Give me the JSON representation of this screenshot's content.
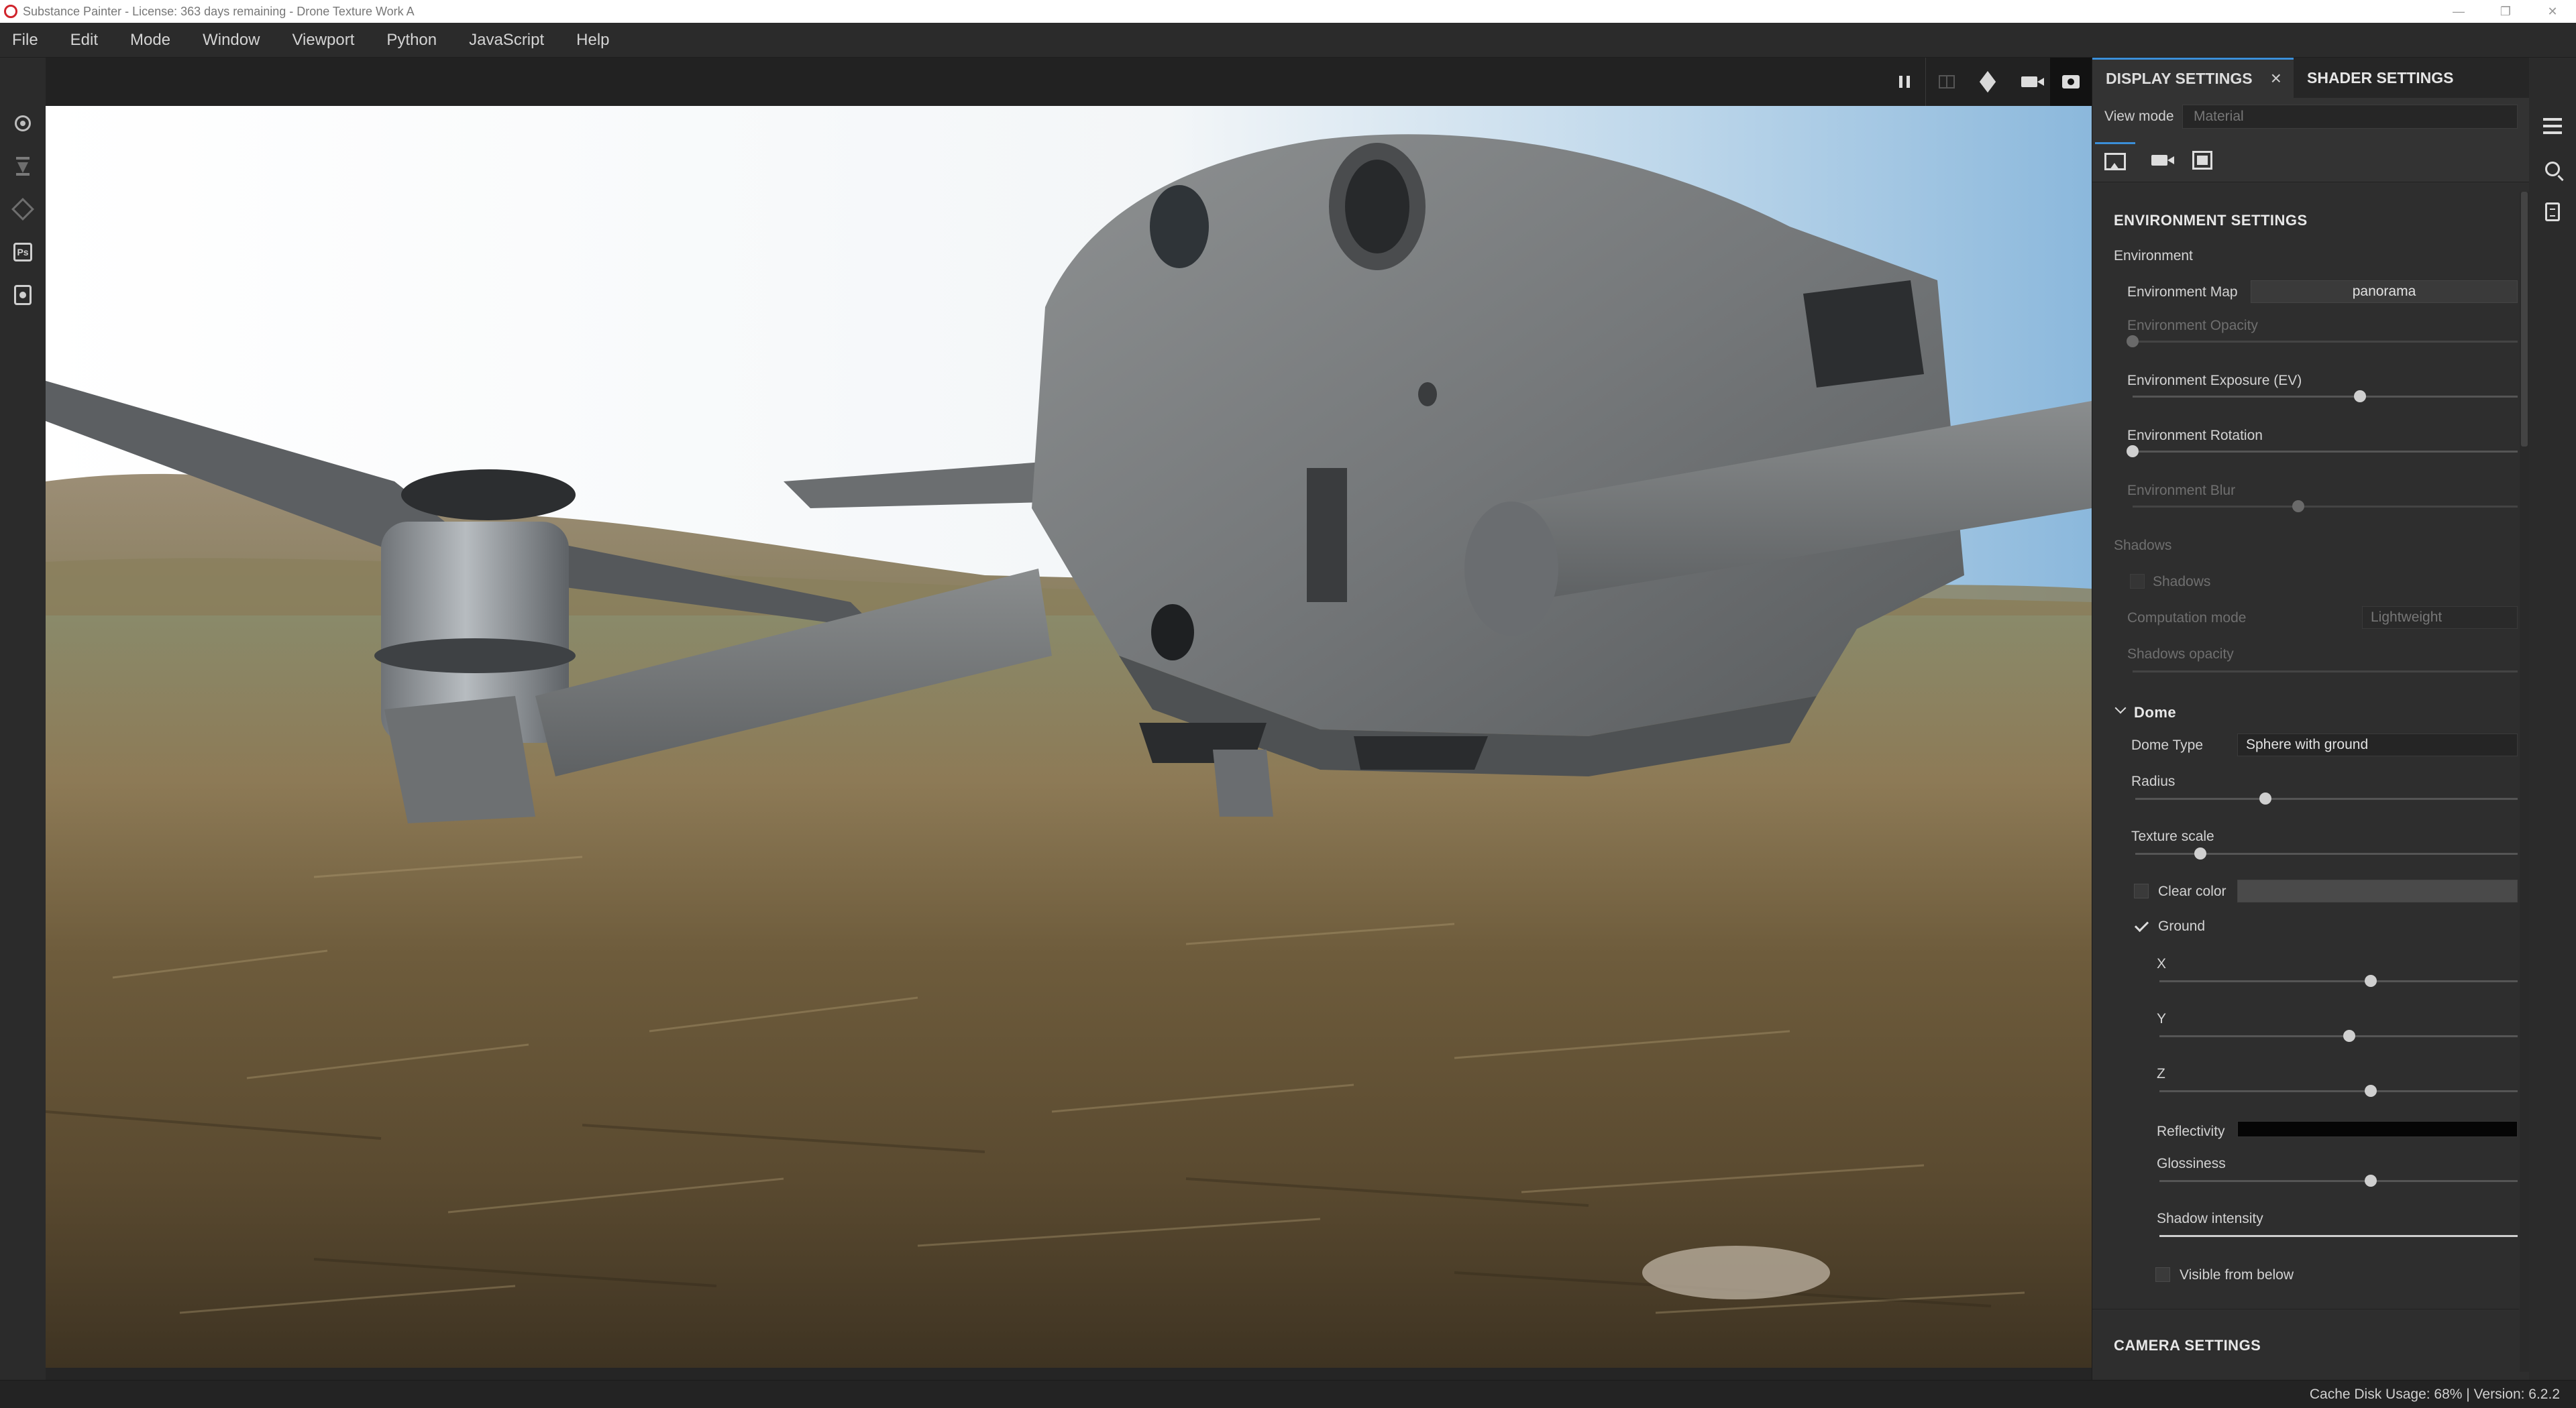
{
  "window": {
    "title": "Substance Painter - License: 363 days remaining - Drone Texture Work A",
    "controls": [
      "—",
      "❐",
      "✕"
    ]
  },
  "menu": [
    "File",
    "Edit",
    "Mode",
    "Window",
    "Viewport",
    "Python",
    "JavaScript",
    "Help"
  ],
  "left_toolbar": [
    "settings-gear-icon",
    "hourglass-icon",
    "layers-icon",
    "photoshop-icon",
    "camera-document-icon"
  ],
  "viewport_toolbar": {
    "icons": [
      "pause-icon",
      "split-view-icon",
      "cube-icon",
      "video-camera-icon",
      "screenshot-camera-icon"
    ]
  },
  "panel": {
    "tabs": {
      "display": "DISPLAY SETTINGS",
      "shader": "SHADER SETTINGS"
    },
    "view_mode": {
      "label": "View mode",
      "value": "Material"
    },
    "icons": [
      "environment-image-icon",
      "camera-icon",
      "frame-icon"
    ],
    "environment": {
      "section": "ENVIRONMENT SETTINGS",
      "group": "Environment",
      "map_label": "Environment Map",
      "map_value": "panorama",
      "opacity_label": "Environment Opacity",
      "opacity_value": 0.0,
      "exposure_label": "Environment Exposure (EV)",
      "exposure_value": 0.59,
      "rotation_label": "Environment Rotation",
      "rotation_value": 0.0,
      "blur_label": "Environment Blur",
      "blur_value": 0.43
    },
    "shadows": {
      "group": "Shadows",
      "checkbox_label": "Shadows",
      "computation_label": "Computation mode",
      "computation_value": "Lightweight",
      "opacity_label": "Shadows opacity"
    },
    "dome": {
      "group": "Dome",
      "type_label": "Dome Type",
      "type_value": "Sphere with ground",
      "radius_label": "Radius",
      "radius_value": 0.34,
      "texture_scale_label": "Texture scale",
      "texture_scale_value": 0.17,
      "clear_color_label": "Clear color",
      "ground_label": "Ground",
      "x_label": "X",
      "x_value": 0.59,
      "y_label": "Y",
      "y_value": 0.53,
      "z_label": "Z",
      "z_value": 0.59,
      "reflectivity_label": "Reflectivity",
      "glossiness_label": "Glossiness",
      "glossiness_value": 0.59,
      "shadow_intensity_label": "Shadow intensity",
      "visible_below_label": "Visible from below"
    },
    "camera_section": "CAMERA SETTINGS"
  },
  "right_toolbar": [
    "layer-stack-icon",
    "zoom-inspect-icon",
    "document-list-icon"
  ],
  "status": {
    "text": "Cache Disk Usage: 68% | Version: 6.2.2"
  },
  "colors": {
    "accent": "#3b8fd9",
    "panel_bg": "#2e2e2e",
    "sky": "#cfe3f2",
    "ground": "#6b5a3e",
    "drone_body": "#7c7f80"
  }
}
